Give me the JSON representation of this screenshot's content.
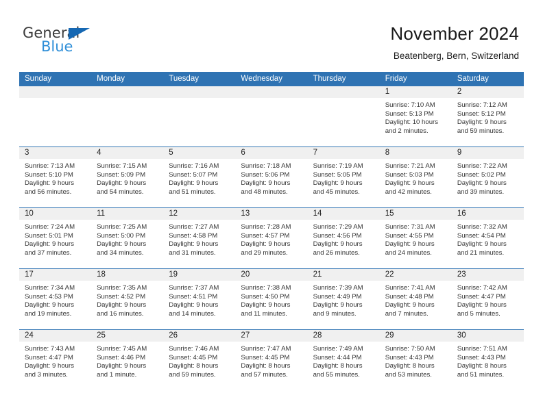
{
  "brand": {
    "name_primary": "General",
    "name_secondary": "Blue",
    "triangle_color": "#1668b3",
    "primary_color": "#3b3b3b",
    "secondary_color": "#2f8fd8"
  },
  "header": {
    "month_title": "November 2024",
    "location": "Beatenberg, Bern, Switzerland"
  },
  "theme": {
    "header_blue": "#2f73b3",
    "date_band_gray": "#f0f0f0",
    "grid_line": "#2f73b3",
    "text": "#333333"
  },
  "calendar": {
    "weekday_headers": [
      "Sunday",
      "Monday",
      "Tuesday",
      "Wednesday",
      "Thursday",
      "Friday",
      "Saturday"
    ],
    "weeks": [
      [
        {
          "day": "",
          "empty": true
        },
        {
          "day": "",
          "empty": true
        },
        {
          "day": "",
          "empty": true
        },
        {
          "day": "",
          "empty": true
        },
        {
          "day": "",
          "empty": true
        },
        {
          "day": "1",
          "sunrise": "Sunrise: 7:10 AM",
          "sunset": "Sunset: 5:13 PM",
          "daylight_line1": "Daylight: 10 hours",
          "daylight_line2": "and 2 minutes."
        },
        {
          "day": "2",
          "sunrise": "Sunrise: 7:12 AM",
          "sunset": "Sunset: 5:12 PM",
          "daylight_line1": "Daylight: 9 hours",
          "daylight_line2": "and 59 minutes."
        }
      ],
      [
        {
          "day": "3",
          "sunrise": "Sunrise: 7:13 AM",
          "sunset": "Sunset: 5:10 PM",
          "daylight_line1": "Daylight: 9 hours",
          "daylight_line2": "and 56 minutes."
        },
        {
          "day": "4",
          "sunrise": "Sunrise: 7:15 AM",
          "sunset": "Sunset: 5:09 PM",
          "daylight_line1": "Daylight: 9 hours",
          "daylight_line2": "and 54 minutes."
        },
        {
          "day": "5",
          "sunrise": "Sunrise: 7:16 AM",
          "sunset": "Sunset: 5:07 PM",
          "daylight_line1": "Daylight: 9 hours",
          "daylight_line2": "and 51 minutes."
        },
        {
          "day": "6",
          "sunrise": "Sunrise: 7:18 AM",
          "sunset": "Sunset: 5:06 PM",
          "daylight_line1": "Daylight: 9 hours",
          "daylight_line2": "and 48 minutes."
        },
        {
          "day": "7",
          "sunrise": "Sunrise: 7:19 AM",
          "sunset": "Sunset: 5:05 PM",
          "daylight_line1": "Daylight: 9 hours",
          "daylight_line2": "and 45 minutes."
        },
        {
          "day": "8",
          "sunrise": "Sunrise: 7:21 AM",
          "sunset": "Sunset: 5:03 PM",
          "daylight_line1": "Daylight: 9 hours",
          "daylight_line2": "and 42 minutes."
        },
        {
          "day": "9",
          "sunrise": "Sunrise: 7:22 AM",
          "sunset": "Sunset: 5:02 PM",
          "daylight_line1": "Daylight: 9 hours",
          "daylight_line2": "and 39 minutes."
        }
      ],
      [
        {
          "day": "10",
          "sunrise": "Sunrise: 7:24 AM",
          "sunset": "Sunset: 5:01 PM",
          "daylight_line1": "Daylight: 9 hours",
          "daylight_line2": "and 37 minutes."
        },
        {
          "day": "11",
          "sunrise": "Sunrise: 7:25 AM",
          "sunset": "Sunset: 5:00 PM",
          "daylight_line1": "Daylight: 9 hours",
          "daylight_line2": "and 34 minutes."
        },
        {
          "day": "12",
          "sunrise": "Sunrise: 7:27 AM",
          "sunset": "Sunset: 4:58 PM",
          "daylight_line1": "Daylight: 9 hours",
          "daylight_line2": "and 31 minutes."
        },
        {
          "day": "13",
          "sunrise": "Sunrise: 7:28 AM",
          "sunset": "Sunset: 4:57 PM",
          "daylight_line1": "Daylight: 9 hours",
          "daylight_line2": "and 29 minutes."
        },
        {
          "day": "14",
          "sunrise": "Sunrise: 7:29 AM",
          "sunset": "Sunset: 4:56 PM",
          "daylight_line1": "Daylight: 9 hours",
          "daylight_line2": "and 26 minutes."
        },
        {
          "day": "15",
          "sunrise": "Sunrise: 7:31 AM",
          "sunset": "Sunset: 4:55 PM",
          "daylight_line1": "Daylight: 9 hours",
          "daylight_line2": "and 24 minutes."
        },
        {
          "day": "16",
          "sunrise": "Sunrise: 7:32 AM",
          "sunset": "Sunset: 4:54 PM",
          "daylight_line1": "Daylight: 9 hours",
          "daylight_line2": "and 21 minutes."
        }
      ],
      [
        {
          "day": "17",
          "sunrise": "Sunrise: 7:34 AM",
          "sunset": "Sunset: 4:53 PM",
          "daylight_line1": "Daylight: 9 hours",
          "daylight_line2": "and 19 minutes."
        },
        {
          "day": "18",
          "sunrise": "Sunrise: 7:35 AM",
          "sunset": "Sunset: 4:52 PM",
          "daylight_line1": "Daylight: 9 hours",
          "daylight_line2": "and 16 minutes."
        },
        {
          "day": "19",
          "sunrise": "Sunrise: 7:37 AM",
          "sunset": "Sunset: 4:51 PM",
          "daylight_line1": "Daylight: 9 hours",
          "daylight_line2": "and 14 minutes."
        },
        {
          "day": "20",
          "sunrise": "Sunrise: 7:38 AM",
          "sunset": "Sunset: 4:50 PM",
          "daylight_line1": "Daylight: 9 hours",
          "daylight_line2": "and 11 minutes."
        },
        {
          "day": "21",
          "sunrise": "Sunrise: 7:39 AM",
          "sunset": "Sunset: 4:49 PM",
          "daylight_line1": "Daylight: 9 hours",
          "daylight_line2": "and 9 minutes."
        },
        {
          "day": "22",
          "sunrise": "Sunrise: 7:41 AM",
          "sunset": "Sunset: 4:48 PM",
          "daylight_line1": "Daylight: 9 hours",
          "daylight_line2": "and 7 minutes."
        },
        {
          "day": "23",
          "sunrise": "Sunrise: 7:42 AM",
          "sunset": "Sunset: 4:47 PM",
          "daylight_line1": "Daylight: 9 hours",
          "daylight_line2": "and 5 minutes."
        }
      ],
      [
        {
          "day": "24",
          "sunrise": "Sunrise: 7:43 AM",
          "sunset": "Sunset: 4:47 PM",
          "daylight_line1": "Daylight: 9 hours",
          "daylight_line2": "and 3 minutes."
        },
        {
          "day": "25",
          "sunrise": "Sunrise: 7:45 AM",
          "sunset": "Sunset: 4:46 PM",
          "daylight_line1": "Daylight: 9 hours",
          "daylight_line2": "and 1 minute."
        },
        {
          "day": "26",
          "sunrise": "Sunrise: 7:46 AM",
          "sunset": "Sunset: 4:45 PM",
          "daylight_line1": "Daylight: 8 hours",
          "daylight_line2": "and 59 minutes."
        },
        {
          "day": "27",
          "sunrise": "Sunrise: 7:47 AM",
          "sunset": "Sunset: 4:45 PM",
          "daylight_line1": "Daylight: 8 hours",
          "daylight_line2": "and 57 minutes."
        },
        {
          "day": "28",
          "sunrise": "Sunrise: 7:49 AM",
          "sunset": "Sunset: 4:44 PM",
          "daylight_line1": "Daylight: 8 hours",
          "daylight_line2": "and 55 minutes."
        },
        {
          "day": "29",
          "sunrise": "Sunrise: 7:50 AM",
          "sunset": "Sunset: 4:43 PM",
          "daylight_line1": "Daylight: 8 hours",
          "daylight_line2": "and 53 minutes."
        },
        {
          "day": "30",
          "sunrise": "Sunrise: 7:51 AM",
          "sunset": "Sunset: 4:43 PM",
          "daylight_line1": "Daylight: 8 hours",
          "daylight_line2": "and 51 minutes."
        }
      ]
    ]
  }
}
